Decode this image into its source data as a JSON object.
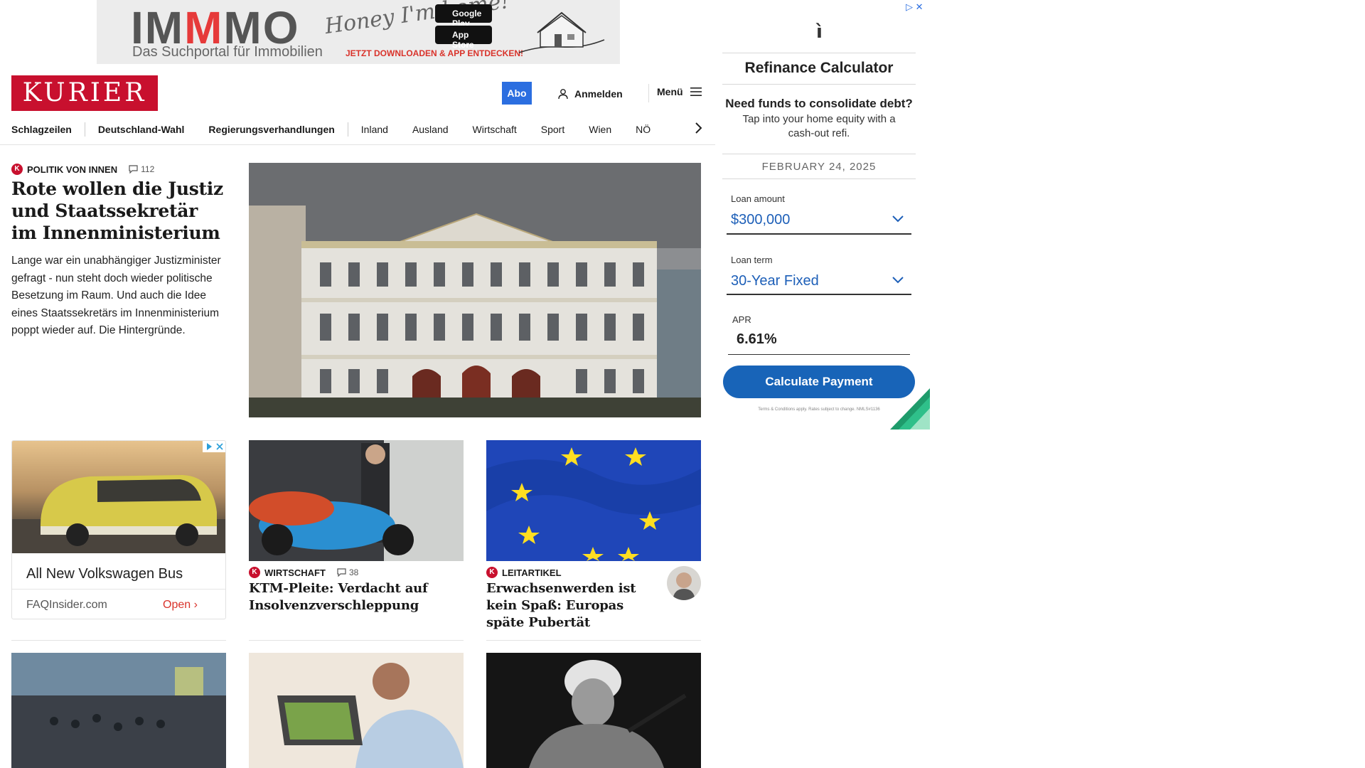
{
  "top_ad": {
    "brand_letters": [
      "IM",
      "M",
      "MO"
    ],
    "tagline": "Das Suchportal für Immobilien",
    "script_text": "Honey I'm home!",
    "google_play": "Google Play",
    "app_store": "App Store",
    "cta": "JETZT DOWNLOADEN & APP ENTDECKEN!"
  },
  "header": {
    "brand": "KURIER",
    "abo": "Abo",
    "login": "Anmelden",
    "menu": "Menü"
  },
  "nav": {
    "items": [
      "Schlagzeilen",
      "Deutschland-Wahl",
      "Regierungsverhandlungen",
      "Inland",
      "Ausland",
      "Wirtschaft",
      "Sport",
      "Wien",
      "NÖ"
    ]
  },
  "lead": {
    "category": "POLITIK VON INNEN",
    "comments": "112",
    "title": "Rote wollen die Justiz und Staatssekretär im Innenministerium",
    "teaser": "Lange war ein unabhängiger Justizminister gefragt - nun steht doch wieder politische Besetzung im Raum. Und auch die Idee eines Staatssekretärs im Innenministerium poppt wieder auf. Die Hintergründe."
  },
  "native_ad": {
    "title": "All New Volkswagen Bus",
    "source": "FAQInsider.com",
    "open": "Open"
  },
  "cards": [
    {
      "category": "WIRTSCHAFT",
      "comments": "38",
      "title": "KTM-Pleite: Verdacht auf Insolvenzverschleppung"
    },
    {
      "category": "LEITARTIKEL",
      "title": "Erwachsenwerden ist kein Spaß: Europas späte Pubertät"
    }
  ],
  "right_ad": {
    "title": "Refinance Calculator",
    "question": "Need funds to consolidate debt?",
    "subtitle": "Tap into your home equity with a cash-out refi.",
    "date": "FEBRUARY 24, 2025",
    "loan_amount_label": "Loan amount",
    "loan_amount": "$300,000",
    "loan_term_label": "Loan term",
    "loan_term": "30-Year Fixed",
    "apr_label": "APR",
    "apr": "6.61%",
    "button": "Calculate Payment",
    "terms": "Terms & Conditions apply. Rates subject to change. NMLS#1136"
  },
  "colors": {
    "brand_red": "#c8102e",
    "abo_blue": "#2b6ee0",
    "calc_blue": "#1864b8"
  }
}
